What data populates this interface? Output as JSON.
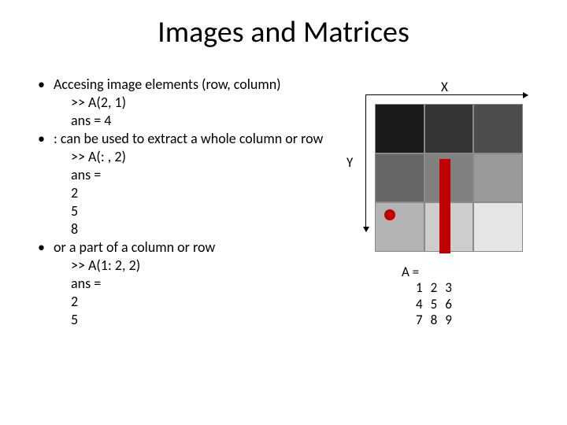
{
  "title": "Images and Matrices",
  "bullets": [
    {
      "head": "Accesing image elements (row, column)",
      "lines": [
        ">> A(2, 1)",
        "ans = 4"
      ]
    },
    {
      "head": ": can be used to extract a whole column or row",
      "lines": [
        ">> A(: , 2)",
        "ans =",
        "2",
        "5",
        "8"
      ]
    },
    {
      "head": " or a part of a column or row",
      "lines": [
        ">> A(1: 2, 2)",
        "ans =",
        "2",
        "5"
      ]
    }
  ],
  "axis": {
    "x": "X",
    "y": "Y"
  },
  "matrix": {
    "label": "A =",
    "rows": [
      [
        "1",
        "2",
        "3"
      ],
      [
        "4",
        "5",
        "6"
      ],
      [
        "7",
        "8",
        "9"
      ]
    ]
  }
}
